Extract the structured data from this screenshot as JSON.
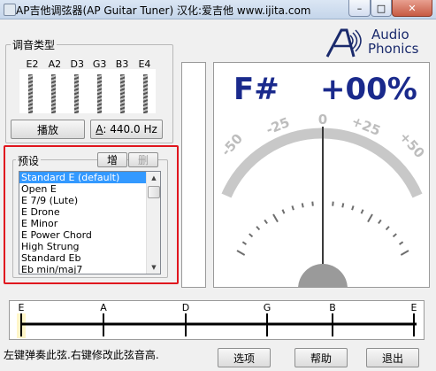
{
  "window": {
    "title": "AP吉他调弦器(AP Guitar Tuner) 汉化:爱吉他 www.ijita.com",
    "minimize_glyph": "–",
    "maximize_glyph": "□",
    "close_glyph": "✕"
  },
  "logo": {
    "line1": "Audio",
    "line2": "Phonics"
  },
  "tuning": {
    "group_label": "调音类型",
    "strings": [
      "E2",
      "A2",
      "D3",
      "G3",
      "B3",
      "E4"
    ],
    "play_button": "播放",
    "reference_prefix": "A",
    "reference_value": ": 440.0 Hz"
  },
  "presets": {
    "group_label": "预设",
    "add_button": "增",
    "delete_button": "删",
    "items": [
      "Standard E (default)",
      "Open E",
      "E 7/9 (Lute)",
      "E Drone",
      "E Minor",
      "E Power Chord",
      "High Strung",
      "Standard Eb",
      "Eb min/maj7"
    ],
    "selected_index": 0
  },
  "meter": {
    "note": "F#",
    "deviation": "+00%",
    "scale_labels": [
      "-50",
      "-25",
      "0",
      "+25",
      "+50"
    ],
    "needle_value": 0
  },
  "fretboard": {
    "labels": [
      "E",
      "A",
      "D",
      "G",
      "B",
      "E"
    ]
  },
  "status": {
    "text": "左键弹奏此弦.右键修改此弦音高."
  },
  "actions": {
    "options": "选项",
    "help": "帮助",
    "exit": "退出"
  },
  "colors": {
    "title_bar": "#c4d5ea",
    "highlight": "#e0161e",
    "selection": "#3399ff",
    "meter_text": "#1a2a8c",
    "logo": "#1a2a6c"
  }
}
